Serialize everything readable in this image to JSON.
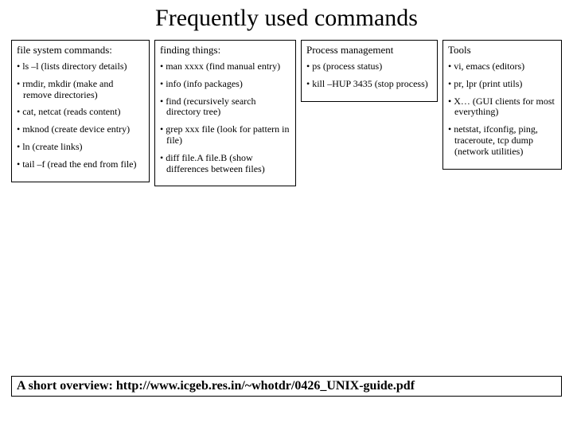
{
  "title": "Frequently used commands",
  "columns": {
    "c1": {
      "heading": "file system commands:",
      "items": [
        "ls –l (lists directory details)",
        "rmdir, mkdir (make and remove directories)",
        "cat, netcat (reads content)",
        "mknod (create device entry)",
        "ln (create links)",
        "tail –f (read the end from file)"
      ]
    },
    "c2": {
      "heading": "finding things:",
      "items": [
        "man xxxx (find manual entry)",
        "info (info packages)",
        "find (recursively search directory tree)",
        "grep xxx file (look for pattern in file)",
        "diff file.A file.B (show differences between files)"
      ]
    },
    "c3": {
      "heading": "Process management",
      "items": [
        "ps (process status)",
        "kill –HUP 3435 (stop process)"
      ]
    },
    "c4": {
      "heading": "Tools",
      "items": [
        "vi, emacs (editors)",
        "pr, lpr (print utils)",
        "X… (GUI clients for most everything)",
        "netstat, ifconfig, ping, traceroute, tcp dump (network utilities)"
      ]
    }
  },
  "footer": "A short overview: http://www.icgeb.res.in/~whotdr/0426_UNIX-guide.pdf"
}
